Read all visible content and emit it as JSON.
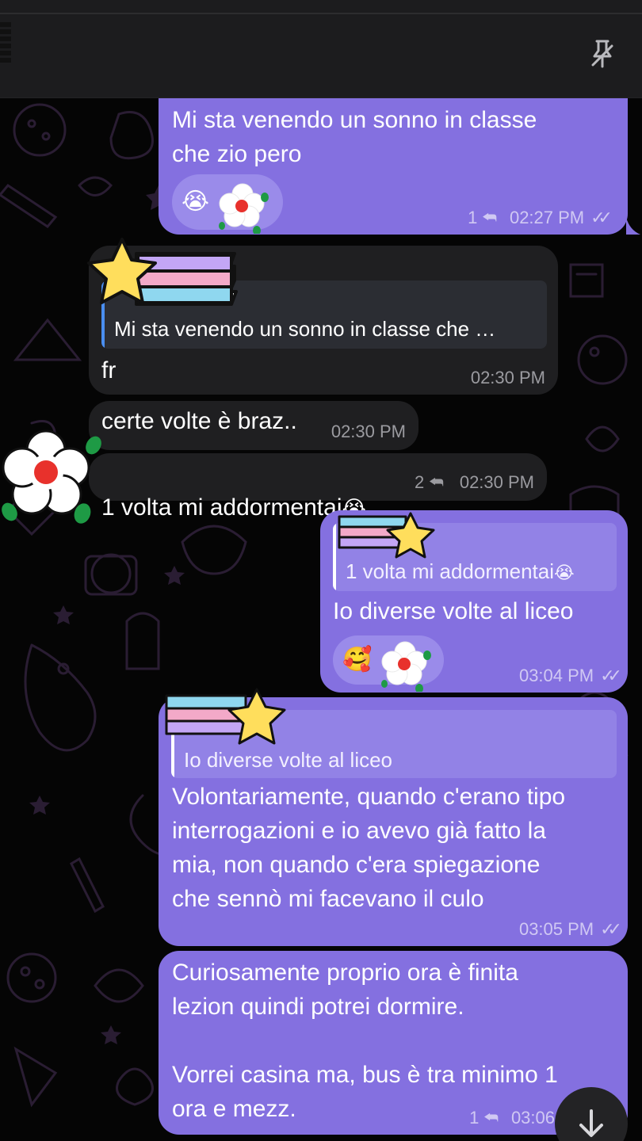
{
  "messages": [
    {
      "id": "m1",
      "text": "Mi sta venendo un sonno in classe\nche zio pero",
      "reactions": [
        "😭",
        "flower-sticker"
      ],
      "replies": "1",
      "time": "02:27 PM",
      "status": "read"
    },
    {
      "id": "m2",
      "quote": "Mi sta venendo un sonno in classe che …",
      "text": "fr",
      "time": "02:30 PM"
    },
    {
      "id": "m3",
      "text": "certe volte è braz..",
      "time": "02:30 PM"
    },
    {
      "id": "m4",
      "text": "1 volta mi addormentai",
      "emoji": "😭",
      "replies": "2",
      "time": "02:30 PM"
    },
    {
      "id": "m5",
      "quote": "1 volta mi addormentai",
      "quote_emoji": "😭",
      "text": "Io diverse volte al liceo",
      "reactions": [
        "🥰",
        "flower-sticker"
      ],
      "time": "03:04 PM",
      "status": "read"
    },
    {
      "id": "m6",
      "quote": "Io diverse volte al liceo",
      "text": "Volontariamente, quando c'erano tipo\ninterrogazioni e io avevo già fatto la\nmia, non quando c'era spiegazione\nche sennò mi facevano il culo",
      "time": "03:05 PM",
      "status": "read"
    },
    {
      "id": "m7",
      "text": "Curiosamente proprio ora è finita\nlezion quindi potrei dormire.\n\nVorrei casina ma, bus è tra minimo 1\nora e mezz.",
      "replies": "1",
      "time": "03:06"
    }
  ],
  "icons": {
    "pin": "unpin-icon",
    "reply": "reply-arrow-icon",
    "check": "double-check-icon",
    "scroll": "arrow-down-icon"
  },
  "colors": {
    "outgoing": "#8470e0",
    "incoming": "#1f1f21",
    "quote_bar_incoming": "#4a8ef0"
  },
  "glyphs": {
    "reply": "⮪",
    "checks": "✓✓"
  }
}
